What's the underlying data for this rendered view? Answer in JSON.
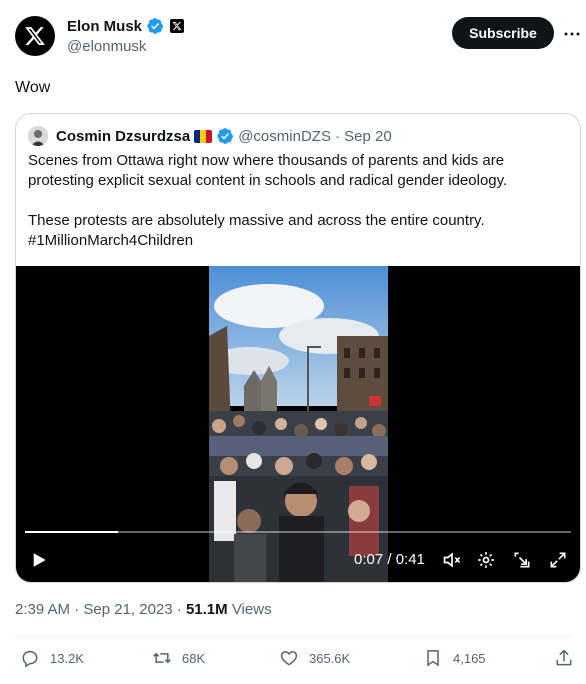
{
  "author": {
    "name": "Elon Musk",
    "handle": "@elonmusk",
    "avatar_icon": "x-logo-icon",
    "verified_icon": "verified-badge-icon",
    "affiliate_icon": "x-affiliate-badge-icon"
  },
  "header": {
    "subscribe_label": "Subscribe",
    "more_icon": "more-options-icon"
  },
  "tweet": {
    "text": "Wow"
  },
  "quote": {
    "name": "Cosmin Dzsurdzsa",
    "handle": "@cosminDZS",
    "date": "· Sep 20",
    "flag_icon": "romania-flag-icon",
    "paragraph1": "Scenes from Ottawa right now where thousands of parents and kids are protesting explicit sexual content in schools and radical gender ideology.",
    "paragraph2": "These protests are absolutely massive and across the entire country.",
    "hashtag": "#1MillionMarch4Children"
  },
  "video": {
    "time": "0:07 / 0:41",
    "progress": 0.17,
    "controls": [
      "play-icon",
      "mute-icon",
      "settings-icon",
      "pop-out-icon",
      "fullscreen-icon"
    ]
  },
  "meta": {
    "timestamp": "2:39 AM · Sep 21, 2023 · ",
    "views_count": "51.1M",
    "views_label": " Views"
  },
  "actions": {
    "replies": "13.2K",
    "reposts": "68K",
    "likes": "365.6K",
    "bookmarks": "4,165"
  },
  "colors": {
    "text_primary": "#0f1419",
    "text_secondary": "#536471",
    "verified_blue": "#1d9bf0",
    "border": "#cfd9de"
  }
}
